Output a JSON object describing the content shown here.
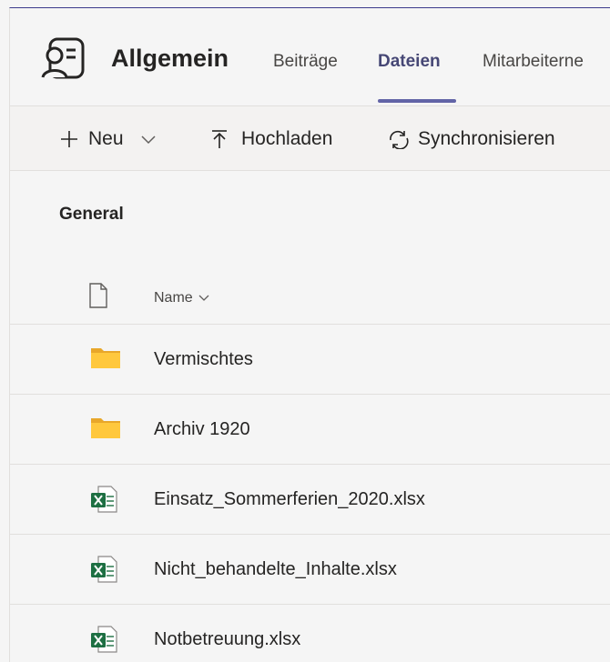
{
  "header": {
    "team_name": "Allgemein",
    "tabs": [
      {
        "label": "Beiträge"
      },
      {
        "label": "Dateien"
      },
      {
        "label": "Mitarbeiterne"
      }
    ]
  },
  "toolbar": {
    "new_label": "Neu",
    "upload_label": "Hochladen",
    "sync_label": "Synchronisieren"
  },
  "section": {
    "title": "General"
  },
  "list": {
    "column_name": "Name",
    "items": [
      {
        "name": "Vermischtes",
        "type": "folder"
      },
      {
        "name": "Archiv 1920",
        "type": "folder"
      },
      {
        "name": "Einsatz_Sommerferien_2020.xlsx",
        "type": "excel"
      },
      {
        "name": "Nicht_behandelte_Inhalte.xlsx",
        "type": "excel"
      },
      {
        "name": "Notbetreuung.xlsx",
        "type": "excel"
      }
    ]
  },
  "colors": {
    "accent": "#6264a7",
    "active_tab_text": "#464775",
    "folder": "#ffc83d",
    "excel": "#1d6f42"
  }
}
